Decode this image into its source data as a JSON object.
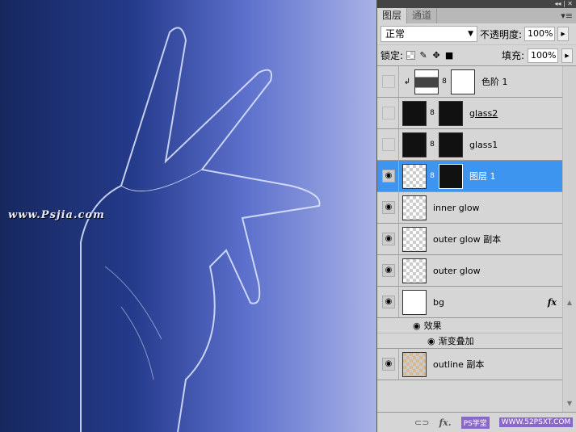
{
  "canvas": {
    "watermark": "www.Psjia.com"
  },
  "panel": {
    "top_controls": "◂◂ | ✕",
    "tabs": [
      {
        "label": "图层",
        "active": true
      },
      {
        "label": "通道",
        "active": false
      }
    ],
    "menu_icon": "panel-menu-icon",
    "blend_mode": "正常",
    "opacity_label": "不透明度:",
    "opacity": "100%",
    "lock_label": "锁定:",
    "fill_label": "填充:",
    "fill": "100%",
    "layers": [
      {
        "name": "色阶 1",
        "visible": false,
        "type": "adjustment"
      },
      {
        "name": "glass2",
        "visible": false,
        "type": "masked"
      },
      {
        "name": "glass1",
        "visible": false,
        "type": "masked"
      },
      {
        "name": "图层 1",
        "visible": true,
        "type": "masked",
        "selected": true
      },
      {
        "name": "inner glow",
        "visible": true
      },
      {
        "name": "outer glow 副本",
        "visible": true
      },
      {
        "name": "outer glow",
        "visible": true
      },
      {
        "name": "bg",
        "visible": true,
        "fx": "fx"
      },
      {
        "name": "outline 副本",
        "visible": true
      }
    ],
    "effects_label": "效果",
    "effect_item": "渐变叠加",
    "bottom": {
      "fx": "fx.",
      "watermark1": "PS学堂",
      "watermark2": "WWW.52PSXT.COM"
    }
  },
  "colors": {
    "selected": "#3d95f0"
  }
}
